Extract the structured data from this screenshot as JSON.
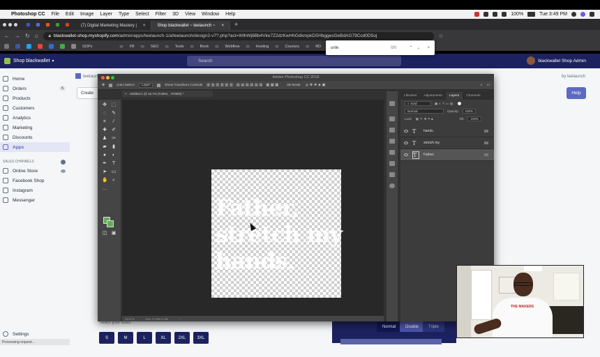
{
  "mac_menu": {
    "apple": "",
    "app_name": "Photoshop CC",
    "items": [
      "File",
      "Edit",
      "Image",
      "Layer",
      "Type",
      "Select",
      "Filter",
      "3D",
      "View",
      "Window",
      "Help"
    ],
    "battery": "100%",
    "clock": "Tue 3:49 PM"
  },
  "browser": {
    "tabs": [
      {
        "label": "(7) Digital Marketing Mastery |"
      },
      {
        "label": "Shop blackwallet ~ teelaunch ~"
      }
    ],
    "new_tab": "+",
    "url_host": "blackwallet-shop.myshopify.com",
    "url_path": "/admin/apps/teelaunch-1/a/teelaunch/design2-v7?.php?act=WlhWj6Bb4Vke7Z2dzKwHhGdkmpkDSHbggesGeBdAG79Ccd0D5oj",
    "bookmarks": [
      "SOPs",
      "FB",
      "SEO",
      "Tools",
      "Book",
      "Webflow",
      "Hosting",
      "Courses",
      "RD"
    ]
  },
  "find_bar": {
    "query": "unle",
    "count": "0/0",
    "prev": "⌃",
    "next": "⌄",
    "close": "×"
  },
  "shopify": {
    "store_name": "Shop blackwallet",
    "search_placeholder": "Search",
    "admin_name": "blackwallet Shop Admin",
    "nav": [
      {
        "label": "Home"
      },
      {
        "label": "Orders",
        "badge": "5"
      },
      {
        "label": "Products"
      },
      {
        "label": "Customers"
      },
      {
        "label": "Analytics"
      },
      {
        "label": "Marketing"
      },
      {
        "label": "Discounts"
      },
      {
        "label": "Apps",
        "selected": true
      }
    ],
    "sales_channels_label": "SALES CHANNELS",
    "channels": [
      "Online Store",
      "Facebook Shop",
      "Instagram",
      "Messenger"
    ],
    "settings_label": "Settings",
    "loading_text": "Processing request...",
    "app_name": "teelaunch",
    "by_label": "by teelaunch",
    "help_label": "Help",
    "create_label": "Create",
    "size_prompt": "Select your sizes",
    "sizes": [
      "S",
      "M",
      "L",
      "XL",
      "2XL",
      "3XL"
    ],
    "styles": [
      "Normal",
      "Double",
      "Triple"
    ]
  },
  "photoshop": {
    "title": "Adobe Photoshop CC 2018",
    "auto_select_label": "Auto-Select:",
    "auto_select_value": "Layer",
    "transform_label": "Show Transform Controls",
    "mode_3d": "3D Mode:",
    "doc_tab": "Untitled-1 @ 16.7% (Father, , RGB/8) *",
    "canvas_text": [
      "Father,",
      "stretch my",
      "hands."
    ],
    "zoom": "16.67%",
    "doc_info": "Doc: 17.8M/14.3M",
    "panel_tabs": [
      "Libraries",
      "Adjustments",
      "Layers",
      "Channels"
    ],
    "active_panel_tab": "Layers",
    "kind_label": "Kind",
    "blend_mode": "Normal",
    "opacity_label": "Opacity:",
    "opacity": "100%",
    "lock_label": "Lock:",
    "fill_label": "Fill:",
    "fill": "100%",
    "layers": [
      {
        "name": "hands."
      },
      {
        "name": "stretch my"
      },
      {
        "name": "Father,",
        "selected": true
      }
    ],
    "fg_color": "#64ac59",
    "bg_color": "#64ac59"
  },
  "webcam": {
    "shirt_text": "THE MAKERS"
  }
}
